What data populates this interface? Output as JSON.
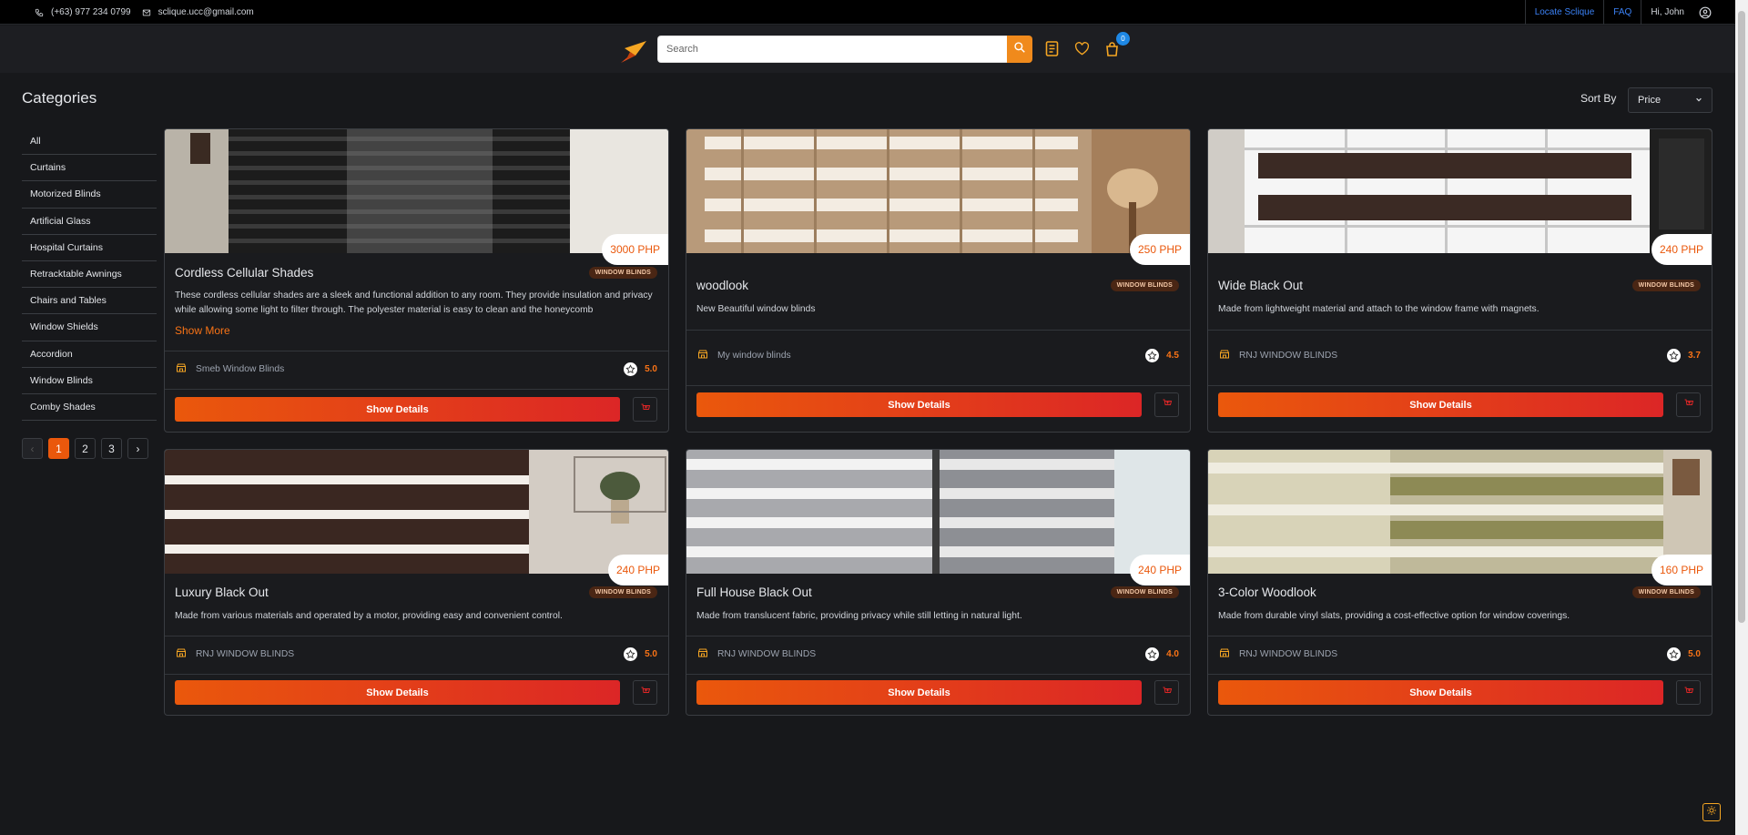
{
  "topbar": {
    "phone": "(+63) 977 234 0799",
    "email": "sclique.ucc@gmail.com",
    "locate": "Locate Sclique",
    "faq": "FAQ",
    "greeting": "Hi, John"
  },
  "header": {
    "search_placeholder": "Search",
    "cart_count": "0"
  },
  "sidebar": {
    "title": "Categories",
    "categories": [
      "All",
      "Curtains",
      "Motorized Blinds",
      "Artificial Glass",
      "Hospital Curtains",
      "Retracktable Awnings",
      "Chairs and Tables",
      "Window Shields",
      "Accordion",
      "Window Blinds",
      "Comby Shades"
    ],
    "pages": [
      "‹",
      "1",
      "2",
      "3",
      "›"
    ],
    "current_page": "1"
  },
  "sort": {
    "label": "Sort By",
    "value": "Price"
  },
  "products": [
    {
      "name": "Cordless Cellular Shades",
      "price": "3000 PHP",
      "category": "WINDOW BLINDS",
      "description": "These cordless cellular shades are a sleek and functional addition to any room. They provide insulation and privacy while allowing some light to filter through. The polyester material is easy to clean and the honeycomb",
      "show_more": "Show More",
      "seller": "Smeb Window Blinds",
      "rating": "5.0",
      "button": "Show Details"
    },
    {
      "name": "woodlook",
      "price": "250 PHP",
      "category": "WINDOW BLINDS",
      "description": "New Beautiful window blinds",
      "seller": "My window blinds",
      "rating": "4.5",
      "button": "Show Details"
    },
    {
      "name": "Wide Black Out",
      "price": "240 PHP",
      "category": "WINDOW BLINDS",
      "description": "Made from lightweight material and attach to the window frame with magnets.",
      "seller": "RNJ WINDOW BLINDS",
      "rating": "3.7",
      "button": "Show Details"
    },
    {
      "name": "Luxury Black Out",
      "price": "240 PHP",
      "category": "WINDOW BLINDS",
      "description": "Made from various materials and operated by a motor, providing easy and convenient control.",
      "seller": "RNJ WINDOW BLINDS",
      "rating": "5.0",
      "button": "Show Details"
    },
    {
      "name": "Full House Black Out",
      "price": "240 PHP",
      "category": "WINDOW BLINDS",
      "description": "Made from translucent fabric, providing privacy while still letting in natural light.",
      "seller": "RNJ WINDOW BLINDS",
      "rating": "4.0",
      "button": "Show Details"
    },
    {
      "name": "3-Color Woodlook",
      "price": "160 PHP",
      "category": "WINDOW BLINDS",
      "description": "Made from durable vinyl slats, providing a cost-effective option for window coverings.",
      "seller": "RNJ WINDOW BLINDS",
      "rating": "5.0",
      "button": "Show Details"
    }
  ],
  "colors": {
    "accent": "#ea580c",
    "accent_end": "#dc2626",
    "background": "#17181b",
    "link": "#3b82f6",
    "badge_bg": "#4a2614"
  }
}
